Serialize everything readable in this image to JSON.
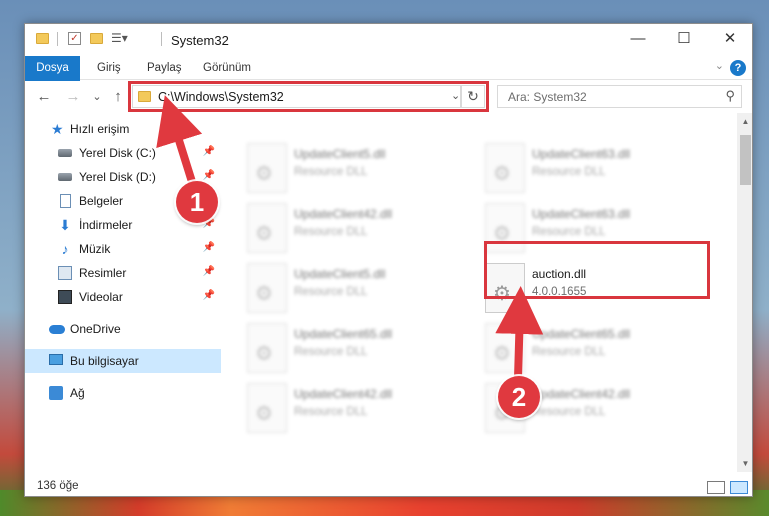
{
  "window": {
    "title": "System32",
    "minimize_label": "—",
    "maximize_label": "☐",
    "close_label": "✕"
  },
  "ribbon": {
    "tabs": [
      "Dosya",
      "Giriş",
      "Paylaş",
      "Görünüm"
    ],
    "help_label": "?",
    "collapse_label": "⌄"
  },
  "nav": {
    "back": "←",
    "forward": "→",
    "recent": "⌄",
    "up": "↑",
    "address_path": "C:\\Windows\\System32",
    "address_dropdown": "⌄",
    "refresh": "↻",
    "search_placeholder": "Ara: System32",
    "search_icon": "⚲"
  },
  "sidebar": {
    "items": [
      {
        "label": "Hızlı erişim",
        "icon": "star-icon"
      },
      {
        "label": "Yerel Disk (C:)",
        "icon": "drive-icon",
        "pinned": true
      },
      {
        "label": "Yerel Disk (D:)",
        "icon": "drive-icon",
        "pinned": true
      },
      {
        "label": "Belgeler",
        "icon": "document-icon",
        "pinned": true
      },
      {
        "label": "İndirmeler",
        "icon": "download-icon",
        "pinned": true
      },
      {
        "label": "Müzik",
        "icon": "music-icon",
        "pinned": true
      },
      {
        "label": "Resimler",
        "icon": "pictures-icon",
        "pinned": true
      },
      {
        "label": "Videolar",
        "icon": "videos-icon",
        "pinned": true
      },
      {
        "label": "OneDrive",
        "icon": "cloud-icon"
      },
      {
        "label": "Bu bilgisayar",
        "icon": "computer-icon",
        "selected": true
      },
      {
        "label": "Ağ",
        "icon": "network-icon"
      }
    ],
    "pin_glyph": "📌"
  },
  "files": [
    {
      "name": "UpdateClient5.dll",
      "sub": "Resource DLL",
      "blurred": true
    },
    {
      "name": "UpdateClient63.dll",
      "sub": "Resource DLL",
      "blurred": true
    },
    {
      "name": "UpdateClient42.dll",
      "sub": "Resource DLL",
      "blurred": true
    },
    {
      "name": "UpdateClient63.dll",
      "sub": "Resource DLL",
      "blurred": true
    },
    {
      "name": "UpdateClient5.dll",
      "sub": "Resource DLL",
      "blurred": true
    },
    {
      "name": "auction.dll",
      "sub": "4.0.0.1655",
      "blurred": false
    },
    {
      "name": "UpdateClient65.dll",
      "sub": "Resource DLL",
      "blurred": true
    },
    {
      "name": "UpdateClient65.dll",
      "sub": "Resource DLL",
      "blurred": true
    },
    {
      "name": "UpdateClient42.dll",
      "sub": "Resource DLL",
      "blurred": true
    },
    {
      "name": "UpdateClient42.dll",
      "sub": "Resource DLL",
      "blurred": true
    }
  ],
  "status": {
    "item_count": "136 öğe"
  },
  "callouts": {
    "first": "1",
    "second": "2"
  },
  "colors": {
    "accent": "#1979ca",
    "highlight": "#d9363e",
    "callout": "#e0393f",
    "selection": "#cce8ff"
  }
}
